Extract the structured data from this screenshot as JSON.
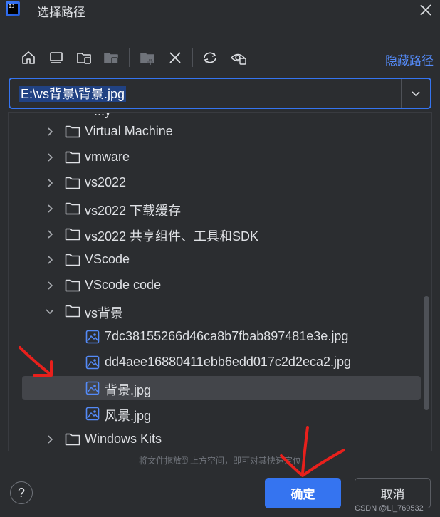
{
  "window": {
    "title": "选择路径",
    "logo_text": "IJ"
  },
  "toolbar": {
    "buttons": [
      "home-icon",
      "desktop-icon",
      "project-folder-icon",
      "module-folder-icon",
      "new-folder-icon",
      "delete-icon",
      "refresh-icon",
      "show-hidden-icon"
    ],
    "hide_path_label": "隐藏路径"
  },
  "path": {
    "value": "E:\\vs背景\\背景.jpg"
  },
  "tree": {
    "partial_top": "...y",
    "rows": [
      {
        "label": "Virtual Machine",
        "type": "folder",
        "expanded": false
      },
      {
        "label": "vmware",
        "type": "folder",
        "expanded": false
      },
      {
        "label": "vs2022",
        "type": "folder",
        "expanded": false
      },
      {
        "label": "vs2022 下载缓存",
        "type": "folder",
        "expanded": false
      },
      {
        "label": "vs2022  共享组件、工具和SDK",
        "type": "folder",
        "expanded": false
      },
      {
        "label": "VScode",
        "type": "folder",
        "expanded": false
      },
      {
        "label": "VScode  code",
        "type": "folder",
        "expanded": false
      },
      {
        "label": "vs背景",
        "type": "folder",
        "expanded": true
      },
      {
        "label": "7dc38155266d46ca8b7fbab897481e3e.jpg",
        "type": "image"
      },
      {
        "label": "dd4aee16880411ebb6edd017c2d2eca2.jpg",
        "type": "image"
      },
      {
        "label": "背景.jpg",
        "type": "image",
        "selected": true
      },
      {
        "label": "风景.jpg",
        "type": "image"
      },
      {
        "label": "Windows Kits",
        "type": "folder",
        "expanded": false
      }
    ]
  },
  "hint": "将文件拖放到上方空间，即可对其快速定位",
  "footer": {
    "help": "?",
    "ok": "确定",
    "cancel": "取消"
  },
  "watermark": "CSDN @Li_769532",
  "colors": {
    "accent": "#3574f0",
    "link": "#548af7",
    "background": "#2b2d30",
    "annotation": "#e8201c"
  }
}
